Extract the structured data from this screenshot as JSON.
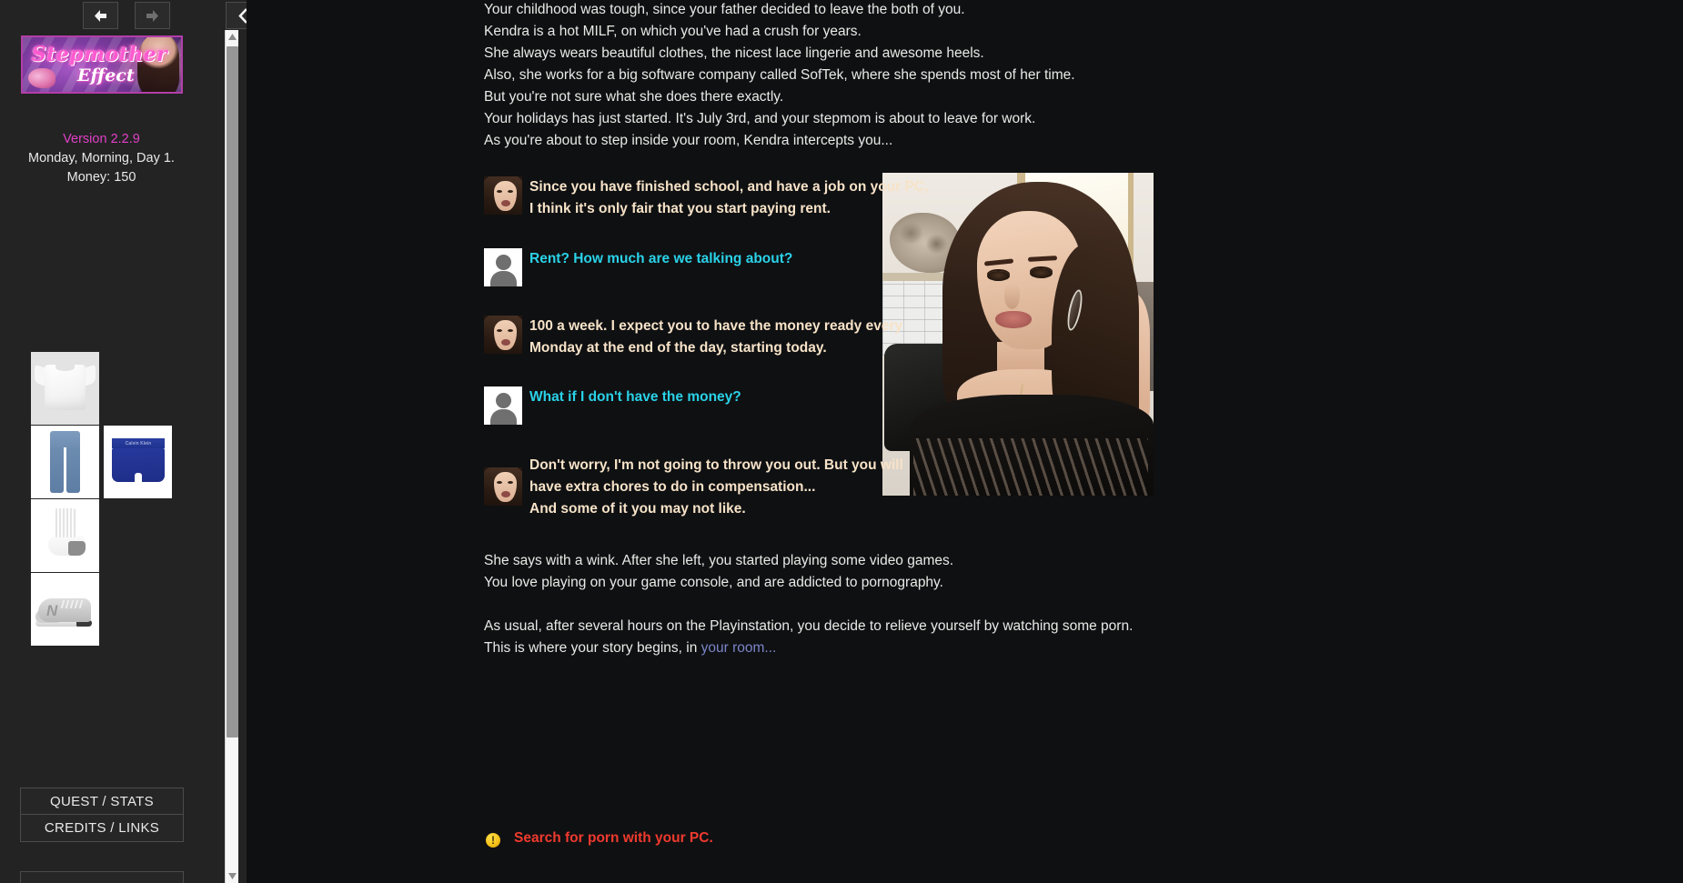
{
  "sidebar": {
    "nav": {
      "back_icon": "arrow-left-icon",
      "forward_icon": "arrow-right-icon",
      "collapse_icon": "chevron-left-icon"
    },
    "banner": {
      "title": "Stepmother",
      "subtitle": "Effect",
      "alt": "stepmother-effect-logo-banner"
    },
    "status": {
      "version": "Version 2.2.9",
      "datetime": "Monday, Morning, Day 1.",
      "money": "Money: 150"
    },
    "inventory": [
      {
        "name": "white-tshirt"
      },
      {
        "name": "blue-jeans"
      },
      {
        "name": "calvin-klein-boxers",
        "brand": "Calvin Klein"
      },
      {
        "name": "white-sock"
      },
      {
        "name": "new-balance-sneaker",
        "logo": "N"
      }
    ],
    "menu": [
      {
        "label": "QUEST / STATS"
      },
      {
        "label": "CREDITS / LINKS"
      }
    ]
  },
  "main": {
    "intro": [
      "Your childhood was tough, since your father decided to leave the both of you.",
      "Kendra is a hot MILF, on which you've had a crush for years.",
      "She always wears beautiful clothes, the nicest lace lingerie and awesome heels.",
      "Also, she works for a big software company called SofTek, where she spends most of her time.",
      "But you're not sure what she does there exactly.",
      "Your holidays has just started. It's July 3rd, and your stepmom is about to leave for work.",
      "As you're about to step inside your room, Kendra intercepts you..."
    ],
    "dialogue": [
      {
        "speaker": "kendra",
        "avatar": "kendra-avatar",
        "lines": [
          "Since you have finished school, and have a job on your PC,",
          "I think it's only fair that you start paying rent."
        ]
      },
      {
        "speaker": "player",
        "avatar": "player-avatar",
        "lines": [
          "Rent? How much are we talking about?"
        ]
      },
      {
        "speaker": "kendra",
        "avatar": "kendra-avatar",
        "lines": [
          "100 a week. I expect you to have the money ready every",
          "Monday at the end of the day, starting today."
        ]
      },
      {
        "speaker": "player",
        "avatar": "player-avatar",
        "lines": [
          "What if I don't have the money?"
        ]
      },
      {
        "speaker": "kendra",
        "avatar": "kendra-avatar",
        "lines": [
          "Don't worry, I'm not going to throw you out. But you will",
          "have extra chores to do in compensation...",
          "And some of it you may not like."
        ]
      }
    ],
    "outro": [
      "She says with a wink. After she left, you started playing some video games.",
      "You love playing on your game console, and are addicted to pornography."
    ],
    "closing": {
      "line1": "As usual, after several hours on the Playinstation, you decide to relieve yourself by watching some porn.",
      "line2_prefix": "This is where your story begins, in ",
      "link": "your room..."
    },
    "action": {
      "icon": "warning-exclamation-icon",
      "icon_glyph": "!",
      "label": "Search for porn with your PC."
    },
    "portrait": {
      "alt": "kendra-portrait-photo"
    }
  },
  "colors": {
    "accent_pink": "#e040c8",
    "kendra_text": "#f7e3c8",
    "player_text": "#2ad2e8",
    "link": "#7a85c8",
    "action_red": "#f03a2e",
    "sidebar_bg": "#232323",
    "main_bg": "#0f1012"
  }
}
